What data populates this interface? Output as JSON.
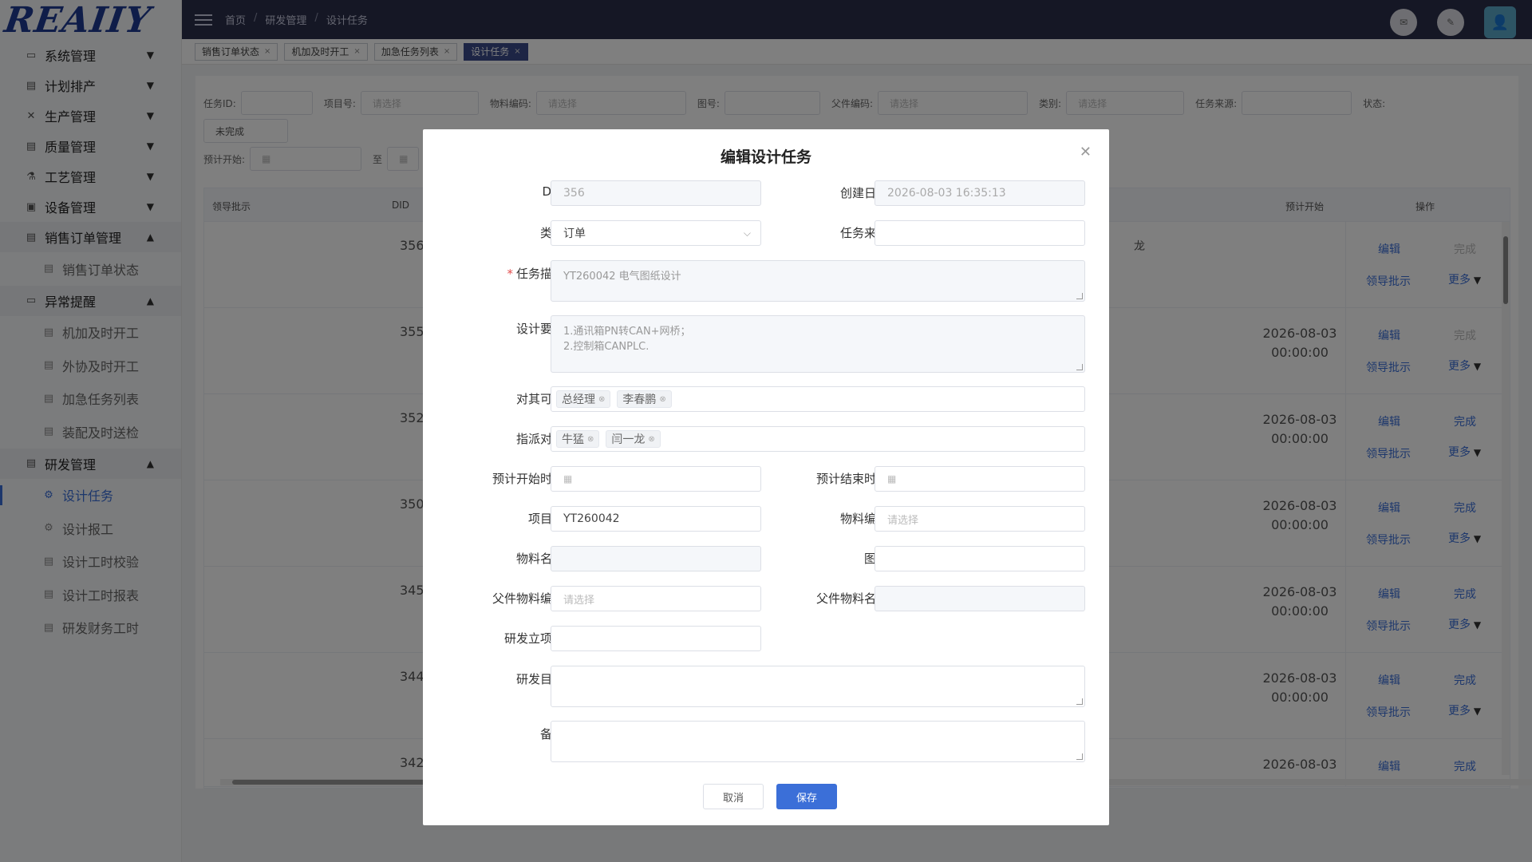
{
  "logo": {
    "text": "REAIIY"
  },
  "sidebar": {
    "groups": [
      {
        "label": "系统管理",
        "icon": "monitor-icon",
        "open": false
      },
      {
        "label": "计划排产",
        "icon": "calendar-icon",
        "open": false
      },
      {
        "label": "生产管理",
        "icon": "tools-icon",
        "open": false
      },
      {
        "label": "质量管理",
        "icon": "document-icon",
        "open": false
      },
      {
        "label": "工艺管理",
        "icon": "flask-icon",
        "open": false
      },
      {
        "label": "设备管理",
        "icon": "machine-icon",
        "open": false
      },
      {
        "label": "销售订单管理",
        "icon": "order-icon",
        "open": true,
        "items": [
          "销售订单状态"
        ]
      },
      {
        "label": "异常提醒",
        "icon": "alert-monitor-icon",
        "open": true,
        "items": [
          "机加及时开工",
          "外协及时开工",
          "加急任务列表",
          "装配及时送检"
        ]
      },
      {
        "label": "研发管理",
        "icon": "rd-icon",
        "open": true,
        "items": [
          "设计任务",
          "设计报工",
          "设计工时校验",
          "设计工时报表",
          "研发财务工时"
        ],
        "active_item": "设计任务"
      }
    ]
  },
  "breadcrumb": [
    "首页",
    "研发管理",
    "设计任务"
  ],
  "tags": [
    {
      "label": "销售订单状态",
      "active": false
    },
    {
      "label": "机加及时开工",
      "active": false
    },
    {
      "label": "加急任务列表",
      "active": false
    },
    {
      "label": "设计任务",
      "active": true
    }
  ],
  "filters": {
    "task_id_label": "任务ID:",
    "project_label": "项目号:",
    "project_ph": "请选择",
    "material_label": "物料编码:",
    "material_ph": "请选择",
    "drawing_label": "图号:",
    "parent_label": "父件编码:",
    "parent_ph": "请选择",
    "category_label": "类别:",
    "category_ph": "请选择",
    "source_label": "任务来源:",
    "status_label": "状态:",
    "status_value": "未完成",
    "start_label": "预计开始:",
    "to_label": "至"
  },
  "table": {
    "headers": {
      "leader": "领导批示",
      "did": "DID",
      "start": "预计开始",
      "ops": "操作"
    },
    "partial_text": "龙",
    "rows": [
      {
        "did": "356",
        "date": "",
        "time": "",
        "done_disabled": true
      },
      {
        "did": "355",
        "date": "2026-08-03",
        "time": "00:00:00",
        "done_disabled": true
      },
      {
        "did": "352",
        "date": "2026-08-03",
        "time": "00:00:00",
        "done_disabled": false
      },
      {
        "did": "350",
        "date": "2026-08-03",
        "time": "00:00:00",
        "done_disabled": false
      },
      {
        "did": "345",
        "date": "2026-08-03",
        "time": "00:00:00",
        "done_disabled": false
      },
      {
        "did": "344",
        "date": "2026-08-03",
        "time": "00:00:00",
        "done_disabled": false
      },
      {
        "did": "342",
        "date": "2026-08-03",
        "time": "",
        "done_disabled": false
      }
    ],
    "op_edit": "编辑",
    "op_done": "完成",
    "op_leader": "领导批示",
    "op_more": "更多"
  },
  "dialog": {
    "title": "编辑设计任务",
    "did_label": "DID",
    "did_value": "356",
    "created_label": "创建日期",
    "created_value": "2026-08-03 16:35:13",
    "category_label": "类别",
    "category_value": "订单",
    "source_label": "任务来源",
    "source_value": "",
    "desc_label": "任务描述",
    "desc_value": "YT260042 电气图纸设计",
    "req_label": "设计要求",
    "req_line1": "1.通讯箱PN转CAN+网桥；",
    "req_line2": "2.控制箱CANPLC.",
    "visible_label": "对其可见",
    "visible_chips": [
      "总经理",
      "李春鹏"
    ],
    "assign_label": "指派对象",
    "assign_chips": [
      "牛猛",
      "闫一龙"
    ],
    "start_label": "预计开始时间",
    "end_label": "预计结束时间",
    "project_label": "项目号",
    "project_value": "YT260042",
    "material_code_label": "物料编码",
    "material_code_ph": "请选择",
    "material_name_label": "物料名称",
    "drawing_label": "图号",
    "parent_code_label": "父件物料编码",
    "parent_code_ph": "请选择",
    "parent_name_label": "父件物料名称",
    "rd_project_label": "研发立项号",
    "rd_purpose_label": "研发目的",
    "remark_label": "备注",
    "cancel": "取消",
    "save": "保存"
  },
  "colors": {
    "primary": "#3b6fd8",
    "topbar": "#2b2f4a",
    "required": "#e34d4d"
  }
}
